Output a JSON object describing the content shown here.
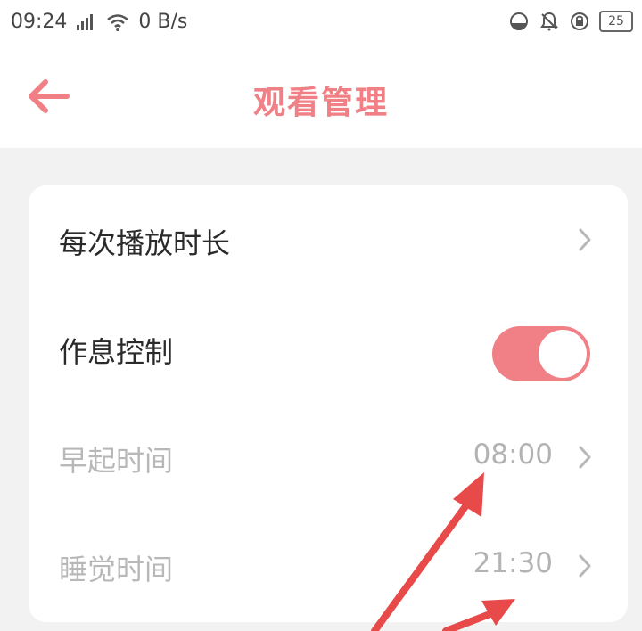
{
  "status_bar": {
    "time": "09:24",
    "network_speed": "0 B/s",
    "battery_level": "25",
    "icons": [
      "signal-icon",
      "wifi-icon",
      "data-saver-icon",
      "bell-icon",
      "vpn-icon",
      "battery-icon"
    ]
  },
  "header": {
    "title": "观看管理",
    "back_icon": "back-arrow-icon"
  },
  "settings": {
    "items": [
      {
        "label": "每次播放时长",
        "value": "",
        "control": "chevron"
      },
      {
        "label": "作息控制",
        "value": "",
        "control": "toggle",
        "toggle_on": true
      },
      {
        "label": "早起时间",
        "value": "08:00",
        "control": "chevron"
      },
      {
        "label": "睡觉时间",
        "value": "21:30",
        "control": "chevron"
      }
    ]
  },
  "colors": {
    "accent": "#f07f86",
    "annotation_arrow": "#e84a4a",
    "muted_text": "#b8b8b8",
    "background": "#f2f2f2"
  }
}
